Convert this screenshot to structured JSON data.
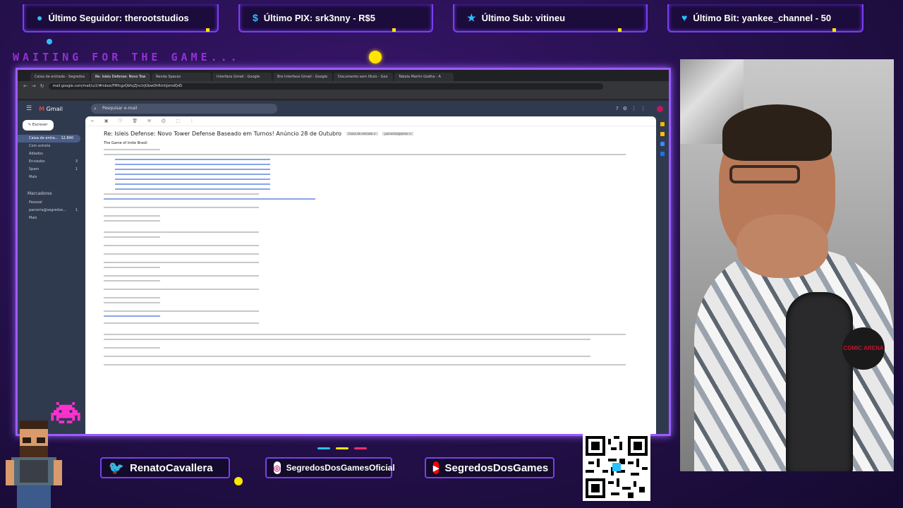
{
  "stats": {
    "follower": "Último Seguidor: therootstudios",
    "pix": "Último PIX: srk3nny - R$5",
    "sub": "Último Sub: vitineu",
    "bit": "Último Bit: yankee_channel - 50"
  },
  "waiting_text": "WAITING FOR THE GAME...",
  "browser": {
    "tabs": [
      "Caixa de entrada - Segredos",
      "Re: Isleis Defense: Novo Tow",
      "Renda Spaces",
      "Interface Gmail - Google",
      "Bro Interface Gmail - Google",
      "Documento sem título - Goo",
      "Tabela Martin Godha - A"
    ],
    "url": "mail.google.com/mail/u/2/#inbox/FMfcgzQbfsjZJnctrJGbwDhRmhJzmdQdS"
  },
  "gmail": {
    "logo": "Gmail",
    "search_placeholder": "Pesquisar e-mail",
    "compose": "Escrever",
    "sidebar": [
      {
        "label": "Caixa de entra...",
        "count": "12.840"
      },
      {
        "label": "Com estrela",
        "count": ""
      },
      {
        "label": "Adiados",
        "count": ""
      },
      {
        "label": "Enviados",
        "count": "3"
      },
      {
        "label": "Spam",
        "count": "1"
      },
      {
        "label": "Mais",
        "count": ""
      }
    ],
    "labels_heading": "Marcadores",
    "labels": [
      {
        "label": "Pessoal",
        "count": ""
      },
      {
        "label": "parceria@segredos...",
        "count": "1"
      },
      {
        "label": "Mais",
        "count": ""
      }
    ],
    "subject": "Re: Isleis Defense: Novo Tower Defense Baseado em Turnos! Anúncio 28 de Outubro",
    "chips": [
      "Caixa de entrada ×",
      "parcerias/games ×"
    ],
    "sender": "The Game of Indie Brasil"
  },
  "social": {
    "twitter": "RenatoCavallera",
    "instagram": "SegredosDosGamesOficial",
    "youtube": "SegredosDosGames"
  },
  "livepix": "livepix.gg/segredosdosgames",
  "webcam_badge": "COMIC ARENA",
  "colors": {
    "frame": "#9b5cff",
    "accent_blue": "#29c0ff",
    "accent_yellow": "#ffe600",
    "youtube_red": "#ff0000"
  },
  "icons": {
    "follower": "person-icon",
    "pix": "dollar-icon",
    "sub": "star-icon",
    "bit": "diamond-icon"
  }
}
